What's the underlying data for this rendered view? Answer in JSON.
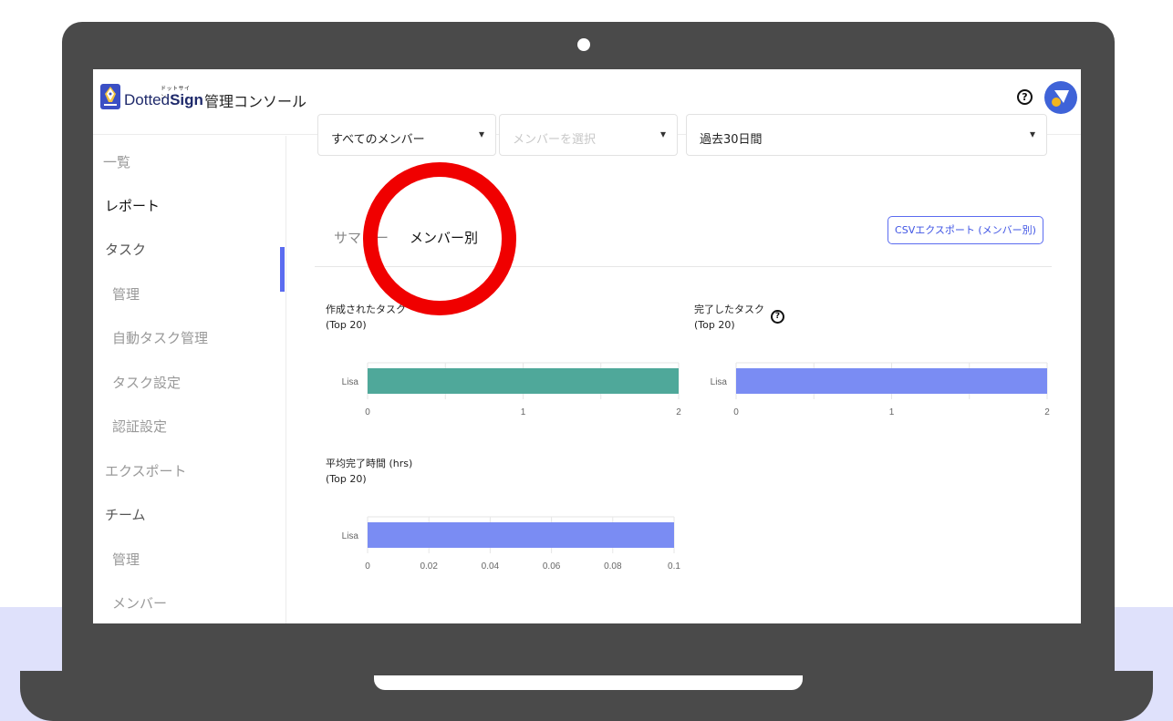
{
  "app": {
    "logo_kana": "ドットサイン",
    "logo_text_a": "Dotted",
    "logo_text_b": "Sign",
    "title": "管理コンソール",
    "help_label": "?"
  },
  "sidebar": {
    "items": [
      {
        "label": "一覧"
      },
      {
        "label": "レポート"
      },
      {
        "label": "タスク"
      },
      {
        "label": "管理"
      },
      {
        "label": "自動タスク管理"
      },
      {
        "label": "タスク設定"
      },
      {
        "label": "認証設定"
      },
      {
        "label": "エクスポート"
      },
      {
        "label": "チーム"
      },
      {
        "label": "管理"
      },
      {
        "label": "メンバー"
      }
    ]
  },
  "filters": {
    "members": "すべてのメンバー",
    "member_select_placeholder": "メンバーを選択",
    "period": "過去30日間"
  },
  "tabs": {
    "summary": "サマリー",
    "by_member": "メンバー別"
  },
  "csv_export_label": "CSVエクスポート (メンバー別)",
  "colors": {
    "accent": "#5b6cf0",
    "created_bar": "#4fa89a",
    "completed_bar": "#7a8cf3",
    "highlight": "#f00000"
  },
  "chart_data": [
    {
      "type": "bar",
      "orientation": "horizontal",
      "title_line1": "作成されたタスク",
      "title_line2": "(Top 20)",
      "categories": [
        "Lisa"
      ],
      "values": [
        2
      ],
      "xlim": [
        0,
        2
      ],
      "ticks": [
        "0",
        "1",
        "2"
      ],
      "tick_values": [
        0,
        1,
        2
      ],
      "color": "#4fa89a"
    },
    {
      "type": "bar",
      "orientation": "horizontal",
      "title_line1": "完了したタスク",
      "title_line2": "(Top 20)",
      "categories": [
        "Lisa"
      ],
      "values": [
        2
      ],
      "xlim": [
        0,
        2
      ],
      "ticks": [
        "0",
        "1",
        "2"
      ],
      "tick_values": [
        0,
        1,
        2
      ],
      "color": "#7a8cf3"
    },
    {
      "type": "bar",
      "orientation": "horizontal",
      "title_line1": "平均完了時間 (hrs)",
      "title_line2": "(Top 20)",
      "categories": [
        "Lisa"
      ],
      "values": [
        0.1
      ],
      "xlim": [
        0,
        0.1
      ],
      "ticks": [
        "0",
        "0.02",
        "0.04",
        "0.06",
        "0.08",
        "0.1"
      ],
      "tick_values": [
        0,
        0.02,
        0.04,
        0.06,
        0.08,
        0.1
      ],
      "color": "#7a8cf3"
    }
  ]
}
